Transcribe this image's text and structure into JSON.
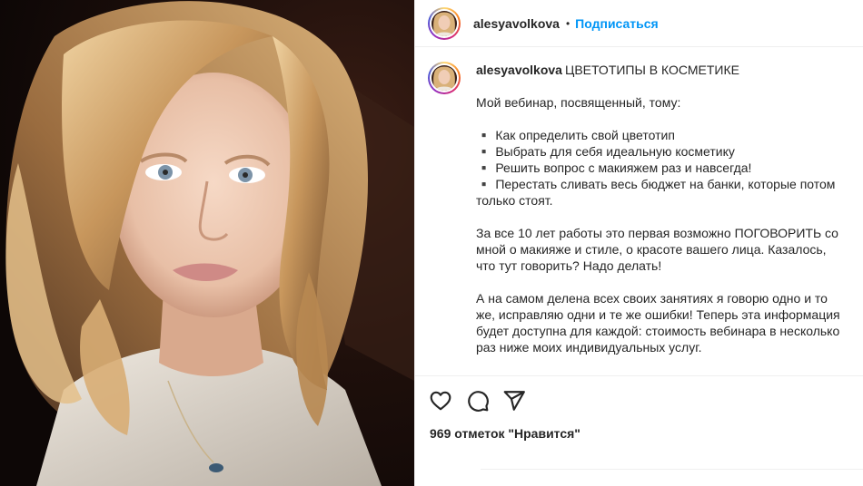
{
  "header": {
    "username": "alesyavolkova",
    "separator": "•",
    "follow_label": "Подписаться"
  },
  "post": {
    "photo_icon": "portrait-photo",
    "caption": {
      "username": "alesyavolkova",
      "title": "ЦВЕТОТИПЫ В КОСМЕТИКЕ",
      "intro": "Мой вебинар, посвященный, тому:",
      "bullets": [
        "▪️ Как определить свой цветотип",
        "▪️ Выбрать для себя идеальную косметику",
        "▪️ Решить вопрос с макияжем раз и навсегда!",
        "▪️ Перестать сливать весь бюджет на банки, которые потом",
        "только стоят."
      ],
      "paragraph2": [
        "За все 10 лет работы это первая возможно ПОГОВОРИТЬ со",
        "мной о макияже и стиле, о красоте вашего лица. Казалось,",
        "что тут говорить? Надо делать!"
      ],
      "paragraph3": [
        "А на самом делена всех своих занятиях я говорю одно и то",
        "же, исправляю одни и те же ошибки! Теперь эта информация",
        "будет доступна для каждой: стоимость вебинара в несколько",
        "раз ниже моих индивидуальных услуг."
      ]
    },
    "actions": {
      "like_icon": "heart-icon",
      "comment_icon": "comment-icon",
      "share_icon": "share-icon"
    },
    "likes_text": "969 отметок \"Нравится\""
  },
  "colors": {
    "accent": "#0095f6",
    "text": "#262626",
    "divider": "#efefef"
  }
}
